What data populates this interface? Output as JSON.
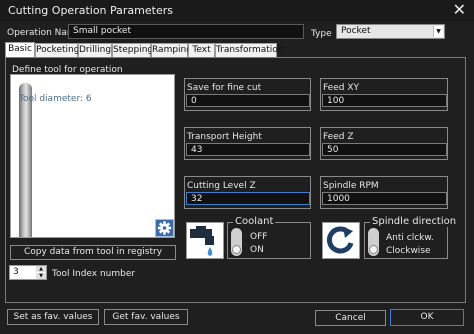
{
  "window": {
    "title": "Cutting Operation Parameters",
    "close_glyph": "✕"
  },
  "header": {
    "operation_name_label": "Operation Name",
    "operation_name_value": "Small pocket",
    "type_label": "Type",
    "type_value": "Pocket"
  },
  "tabs": [
    {
      "label": "Basic"
    },
    {
      "label": "Pocketing"
    },
    {
      "label": "Drilling"
    },
    {
      "label": "Stepping"
    },
    {
      "label": "Ramping"
    },
    {
      "label": "Text"
    },
    {
      "label": "Transformation"
    }
  ],
  "tool": {
    "define_label": "Define tool for operation",
    "diameter_text": "Tool diameter: 6",
    "copy_button": "Copy data from tool in registry",
    "index_value": "3",
    "index_label": "Tool Index number"
  },
  "fields": {
    "save_fine_cut": {
      "label": "Save for fine cut",
      "value": "0"
    },
    "feed_xy": {
      "label": "Feed XY",
      "value": "100"
    },
    "transport_height": {
      "label": "Transport Height",
      "value": "43"
    },
    "feed_z": {
      "label": "Feed Z",
      "value": "50"
    },
    "cutting_level_z": {
      "label": "Cutting Level Z",
      "value": "32"
    },
    "spindle_rpm": {
      "label": "Spindle RPM",
      "value": "1000"
    }
  },
  "coolant": {
    "label": "Coolant",
    "off": "OFF",
    "on": "ON",
    "state": "ON"
  },
  "spindle": {
    "label": "Spindle direction",
    "anti": "Anti clckw.",
    "clockwise": "Clockwise",
    "state": "Clockwise"
  },
  "footer": {
    "set_fav": "Set as fav. values",
    "get_fav": "Get fav. values",
    "cancel": "Cancel",
    "ok": "OK"
  },
  "colors": {
    "accent": "#3c7fd0",
    "panel_bg": "#1f1f1f",
    "field_bg": "#111111"
  }
}
